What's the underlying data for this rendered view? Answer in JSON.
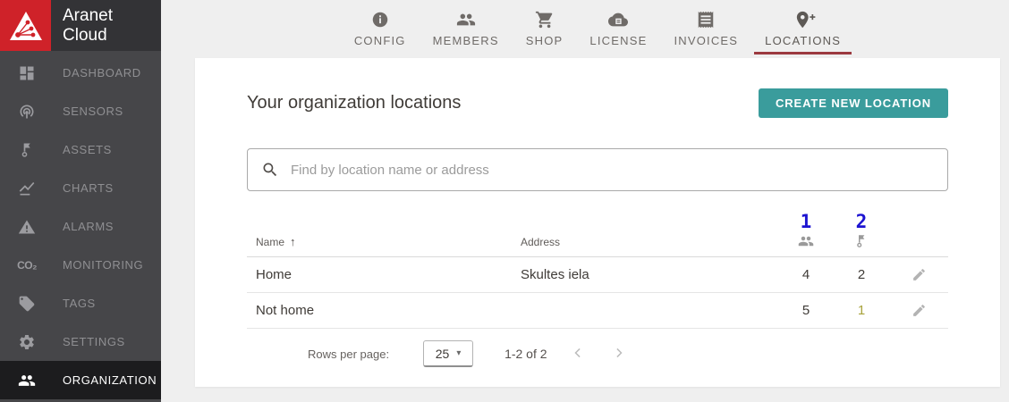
{
  "sidebar": {
    "logo_line1": "Aranet",
    "logo_line2": "Cloud",
    "co2_glyph": "CO₂",
    "items": [
      {
        "label": "DASHBOARD",
        "icon": "dashboard-icon",
        "active": false
      },
      {
        "label": "SENSORS",
        "icon": "sensors-icon",
        "active": false
      },
      {
        "label": "ASSETS",
        "icon": "flag-icon",
        "active": false
      },
      {
        "label": "CHARTS",
        "icon": "chart-icon",
        "active": false
      },
      {
        "label": "ALARMS",
        "icon": "warning-icon",
        "active": false
      },
      {
        "label": "MONITORING",
        "icon": "co2-icon",
        "active": false
      },
      {
        "label": "TAGS",
        "icon": "tag-icon",
        "active": false
      },
      {
        "label": "SETTINGS",
        "icon": "gear-icon",
        "active": false
      },
      {
        "label": "ORGANIZATION",
        "icon": "people-icon",
        "active": true
      }
    ]
  },
  "topnav": {
    "tabs": [
      {
        "label": "CONFIG",
        "icon": "info-icon",
        "active": false
      },
      {
        "label": "MEMBERS",
        "icon": "people-icon",
        "active": false
      },
      {
        "label": "SHOP",
        "icon": "cart-icon",
        "active": false
      },
      {
        "label": "LICENSE",
        "icon": "cloud-icon",
        "active": false
      },
      {
        "label": "INVOICES",
        "icon": "receipt-icon",
        "active": false
      },
      {
        "label": "LOCATIONS",
        "icon": "location-add-icon",
        "active": true
      }
    ]
  },
  "main": {
    "title": "Your organization locations",
    "create_button_label": "CREATE NEW LOCATION",
    "search_placeholder": "Find by location name or address",
    "table": {
      "header": {
        "name": "Name",
        "sort_indicator": "↑",
        "address": "Address"
      },
      "rows": [
        {
          "name": "Home",
          "address": "Skultes iela",
          "members": "4",
          "assets": "2"
        },
        {
          "name": "Not home",
          "address": "",
          "members": "5",
          "assets": "1"
        }
      ]
    },
    "pagination": {
      "rows_per_page_label": "Rows per page:",
      "rows_per_page_value": "25",
      "caret": "▾",
      "range": "1-2 of 2"
    }
  },
  "annotations": {
    "members_column": "1",
    "assets_column": "2"
  },
  "colors": {
    "brand_red": "#cf2229",
    "accent_teal": "#3a9c9c",
    "active_tab_underline": "#9c3a40",
    "annotation_blue": "#1c13d1",
    "assets_warning_olive": "#a8a33c"
  }
}
